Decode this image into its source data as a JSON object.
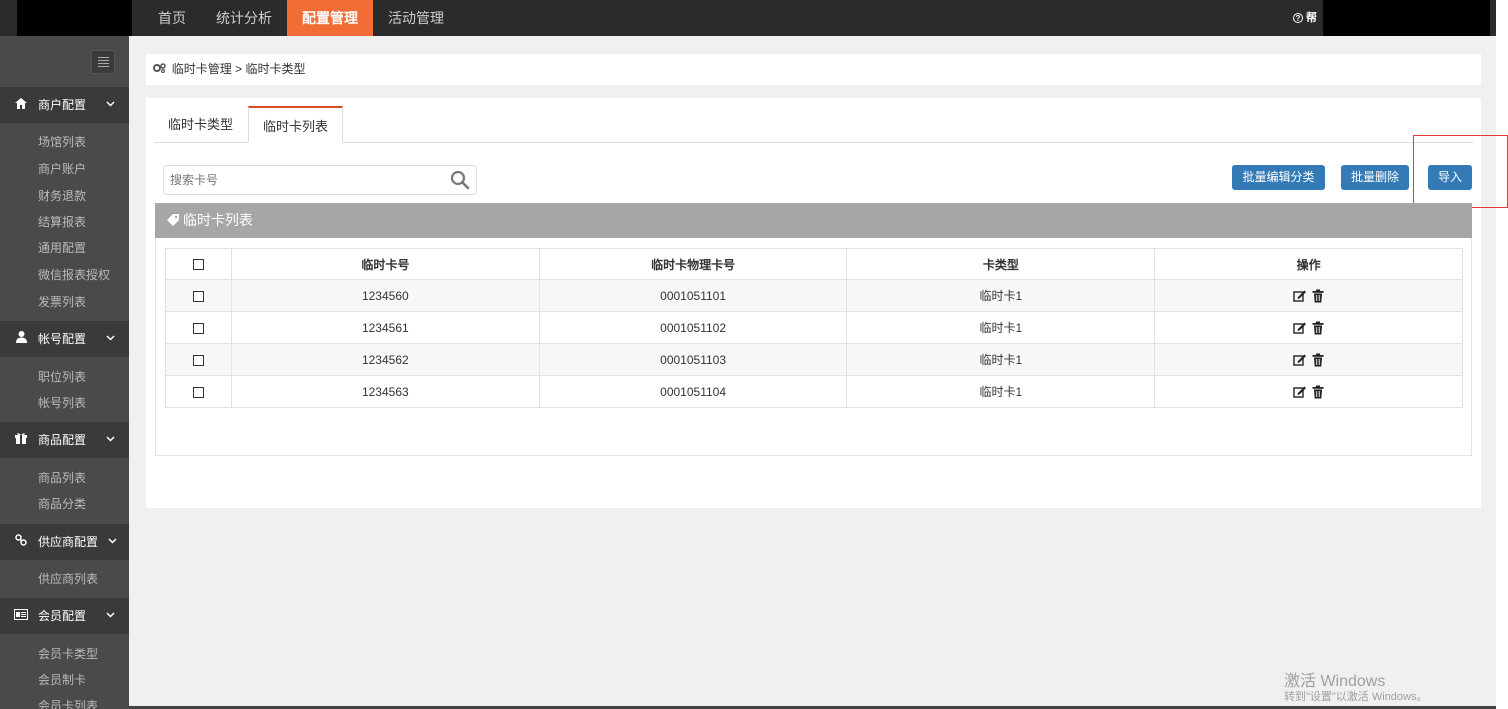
{
  "topnav": {
    "items": [
      {
        "label": "首页"
      },
      {
        "label": "统计分析"
      },
      {
        "label": "配置管理",
        "active": true
      },
      {
        "label": "活动管理"
      }
    ],
    "help_label": "帮",
    "accent_color": "#f26c35"
  },
  "sidebar": {
    "groups": [
      {
        "label": "商户配置",
        "icon": "home-icon",
        "items": [
          "场馆列表",
          "商户账户",
          "财务退款",
          "结算报表",
          "通用配置",
          "微信报表授权",
          "发票列表"
        ]
      },
      {
        "label": "帐号配置",
        "icon": "user-icon",
        "items": [
          "职位列表",
          "帐号列表"
        ]
      },
      {
        "label": "商品配置",
        "icon": "gift-icon",
        "items": [
          "商品列表",
          "商品分类"
        ]
      },
      {
        "label": "供应商配置",
        "icon": "link-icon",
        "items": [
          "供应商列表"
        ]
      },
      {
        "label": "会员配置",
        "icon": "id-card-icon",
        "items": [
          "会员卡类型",
          "会员制卡",
          "会员卡列表"
        ]
      }
    ]
  },
  "breadcrumb": {
    "parent": "临时卡管理",
    "separator": ">",
    "current": "临时卡类型"
  },
  "tabs": [
    {
      "label": "临时卡类型",
      "active": false
    },
    {
      "label": "临时卡列表",
      "active": true
    }
  ],
  "search": {
    "placeholder": "搜索卡号",
    "value": ""
  },
  "buttons": {
    "batch_edit": "批量编辑分类",
    "batch_delete": "批量删除",
    "import": "导入",
    "color": "#337ab7"
  },
  "list": {
    "title": "临时卡列表",
    "columns": [
      "临时卡号",
      "临时卡物理卡号",
      "卡类型",
      "操作"
    ],
    "rows": [
      {
        "card_no": "1234560",
        "physical_no": "0001051101",
        "type": "临时卡1"
      },
      {
        "card_no": "1234561",
        "physical_no": "0001051102",
        "type": "临时卡1"
      },
      {
        "card_no": "1234562",
        "physical_no": "0001051103",
        "type": "临时卡1"
      },
      {
        "card_no": "1234563",
        "physical_no": "0001051104",
        "type": "临时卡1"
      }
    ]
  },
  "watermark": {
    "line1": "激活 Windows",
    "line2": "转到\"设置\"以激活 Windows。"
  }
}
